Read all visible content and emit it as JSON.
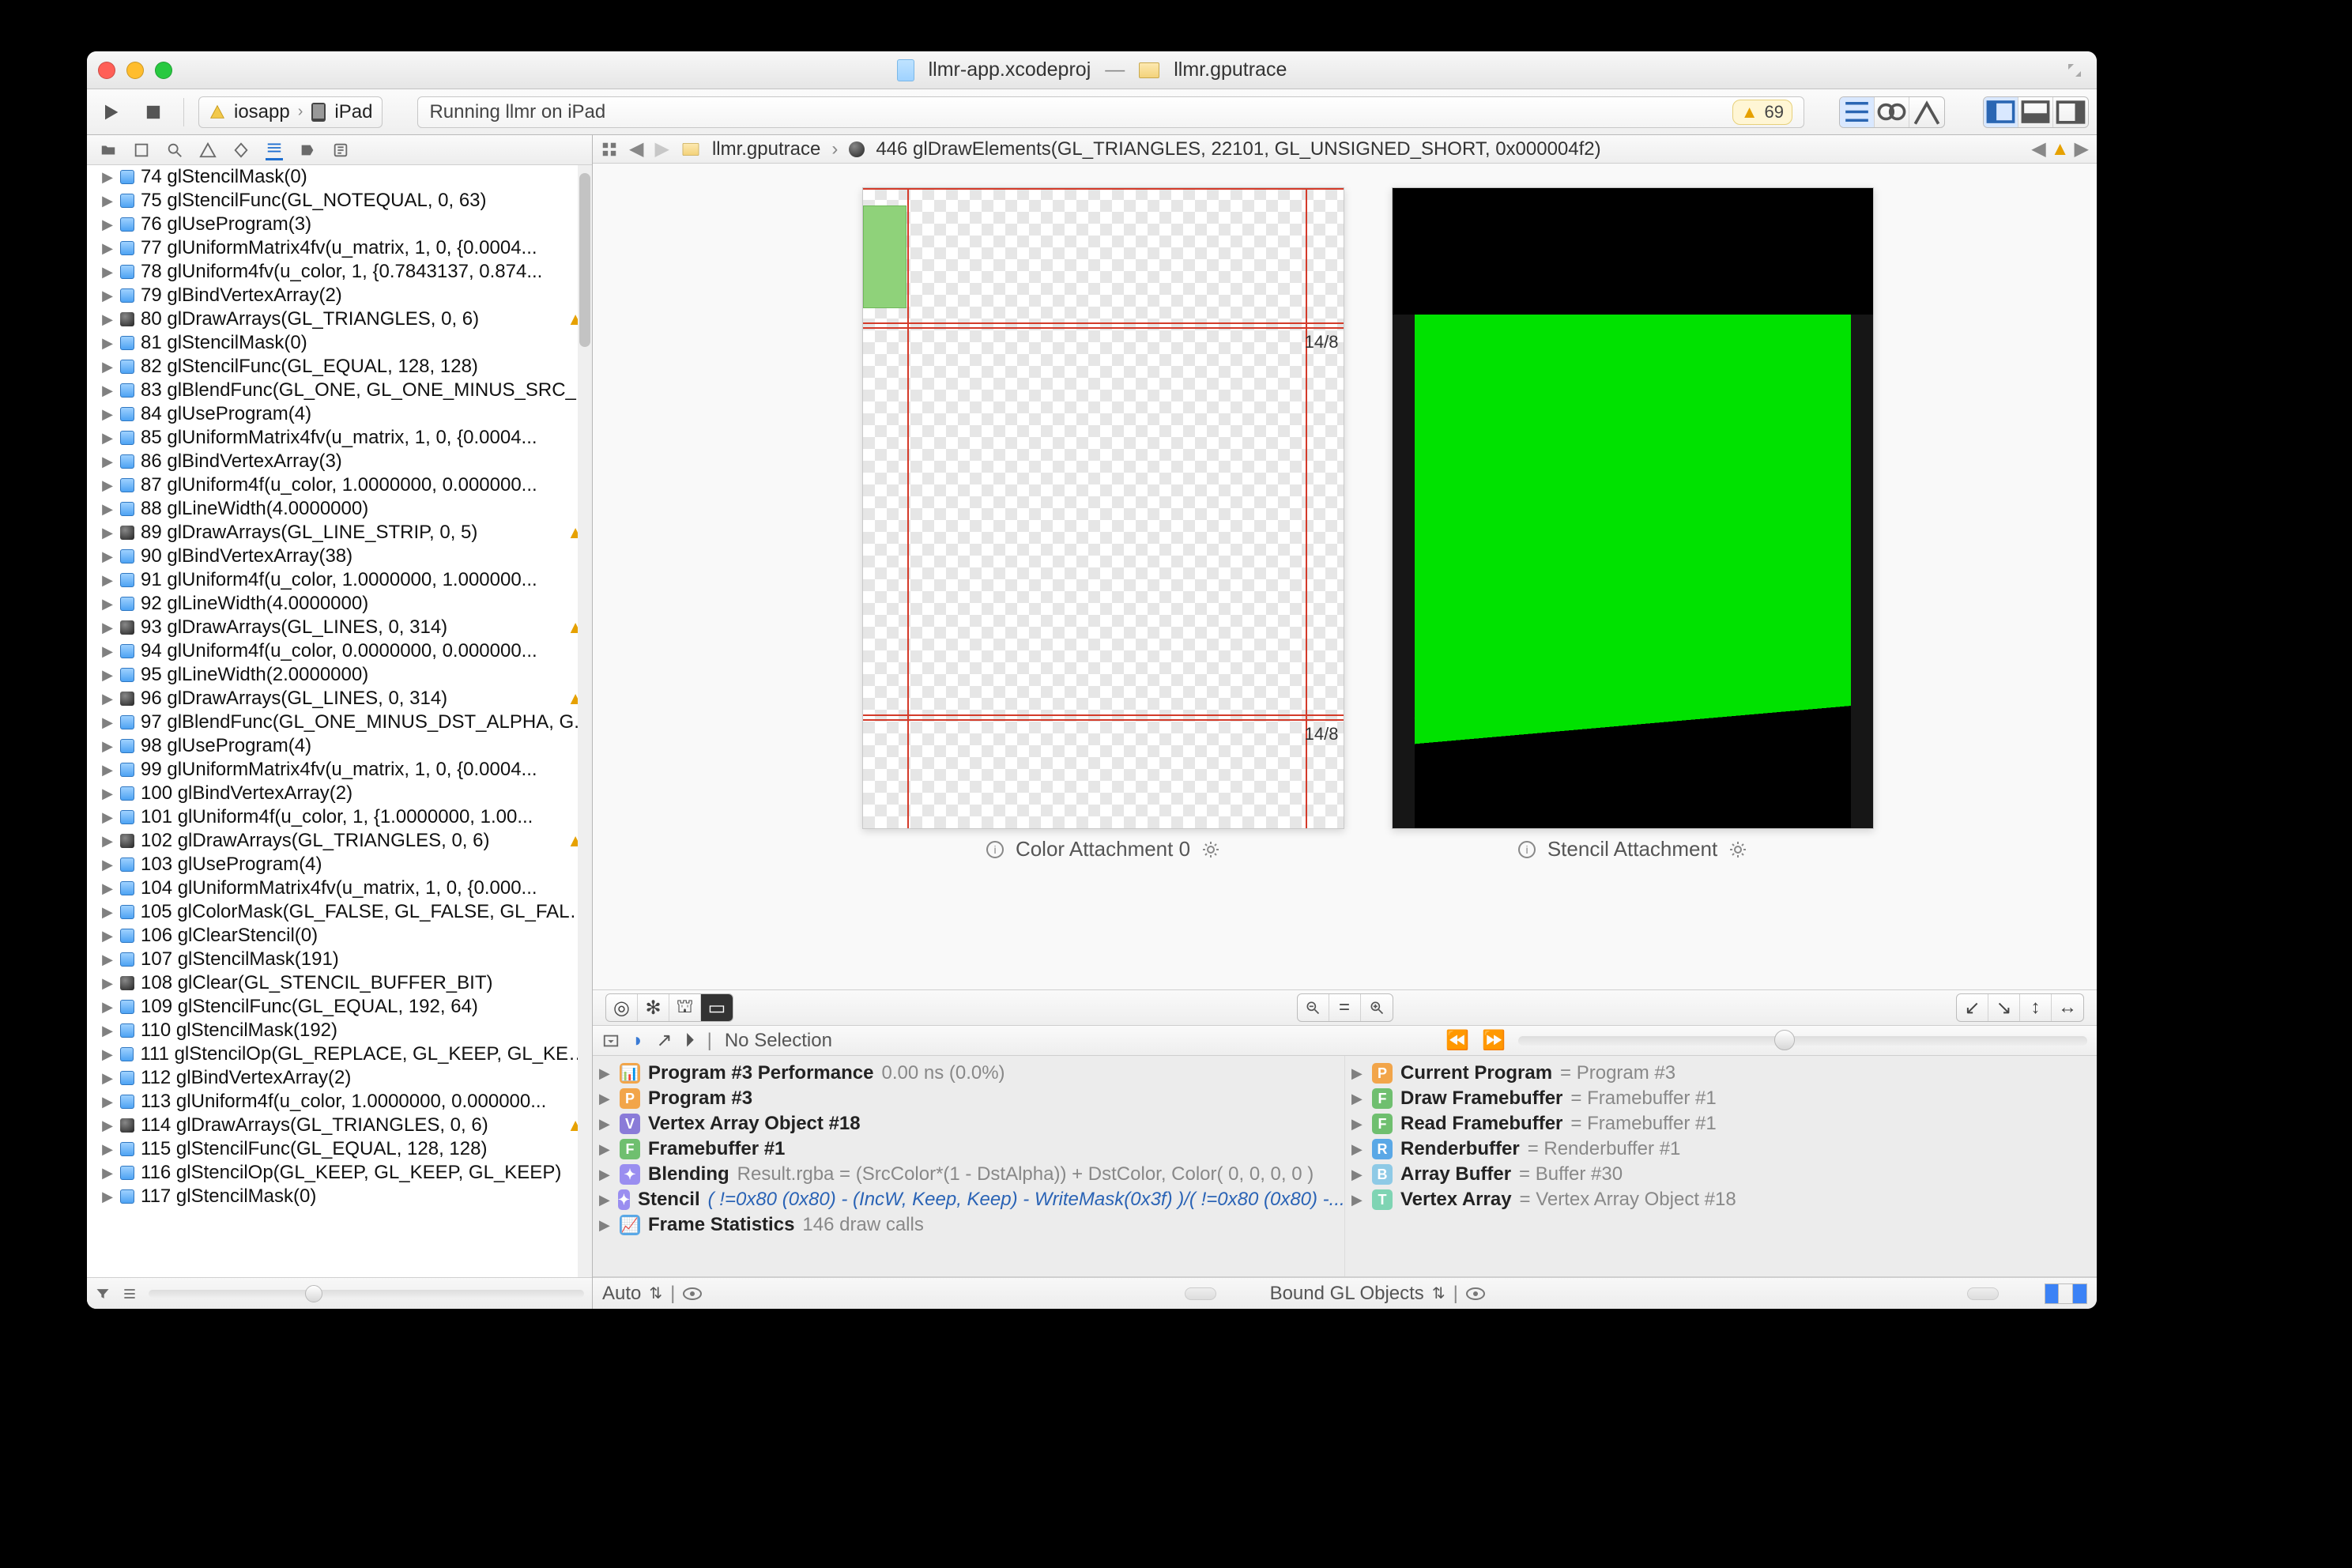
{
  "title": {
    "doc": "llmr-app.xcodeproj",
    "sep": "—",
    "trace": "llmr.gputrace"
  },
  "scheme": {
    "app": "iosapp",
    "device": "iPad"
  },
  "status": {
    "text": "Running llmr on iPad",
    "warn_count": "69"
  },
  "jump": {
    "file": "llmr.gputrace",
    "call": "446 glDrawElements(GL_TRIANGLES, 22101, GL_UNSIGNED_SHORT, 0x000004f2)"
  },
  "attachments": {
    "left": "Color Attachment 0",
    "right": "Stencil Attachment",
    "tag1": "14/8",
    "tag2": "14/8"
  },
  "selbar": {
    "label": "No Selection"
  },
  "bottom": {
    "auto": "Auto",
    "bound": "Bound GL Objects"
  },
  "tree_rows": [
    {
      "n": "74",
      "t": "glStencilMask(0)",
      "b": "blue"
    },
    {
      "n": "75",
      "t": "glStencilFunc(GL_NOTEQUAL, 0, 63)",
      "b": "blue"
    },
    {
      "n": "76",
      "t": "glUseProgram(3)",
      "b": "blue"
    },
    {
      "n": "77",
      "t": "glUniformMatrix4fv(u_matrix, 1, 0, {0.0004...",
      "b": "blue"
    },
    {
      "n": "78",
      "t": "glUniform4fv(u_color, 1, {0.7843137, 0.874...",
      "b": "blue"
    },
    {
      "n": "79",
      "t": "glBindVertexArray(2)",
      "b": "blue"
    },
    {
      "n": "80",
      "t": "glDrawArrays(GL_TRIANGLES, 0, 6)",
      "b": "dark",
      "w": true
    },
    {
      "n": "81",
      "t": "glStencilMask(0)",
      "b": "blue"
    },
    {
      "n": "82",
      "t": "glStencilFunc(GL_EQUAL, 128, 128)",
      "b": "blue"
    },
    {
      "n": "83",
      "t": "glBlendFunc(GL_ONE, GL_ONE_MINUS_SRC_...",
      "b": "blue"
    },
    {
      "n": "84",
      "t": "glUseProgram(4)",
      "b": "blue"
    },
    {
      "n": "85",
      "t": "glUniformMatrix4fv(u_matrix, 1, 0, {0.0004...",
      "b": "blue"
    },
    {
      "n": "86",
      "t": "glBindVertexArray(3)",
      "b": "blue"
    },
    {
      "n": "87",
      "t": "glUniform4f(u_color, 1.0000000, 0.000000...",
      "b": "blue"
    },
    {
      "n": "88",
      "t": "glLineWidth(4.0000000)",
      "b": "blue"
    },
    {
      "n": "89",
      "t": "glDrawArrays(GL_LINE_STRIP, 0, 5)",
      "b": "dark",
      "w": true
    },
    {
      "n": "90",
      "t": "glBindVertexArray(38)",
      "b": "blue"
    },
    {
      "n": "91",
      "t": "glUniform4f(u_color, 1.0000000, 1.000000...",
      "b": "blue"
    },
    {
      "n": "92",
      "t": "glLineWidth(4.0000000)",
      "b": "blue"
    },
    {
      "n": "93",
      "t": "glDrawArrays(GL_LINES, 0, 314)",
      "b": "dark",
      "w": true
    },
    {
      "n": "94",
      "t": "glUniform4f(u_color, 0.0000000, 0.000000...",
      "b": "blue"
    },
    {
      "n": "95",
      "t": "glLineWidth(2.0000000)",
      "b": "blue"
    },
    {
      "n": "96",
      "t": "glDrawArrays(GL_LINES, 0, 314)",
      "b": "dark",
      "w": true
    },
    {
      "n": "97",
      "t": "glBlendFunc(GL_ONE_MINUS_DST_ALPHA, G...",
      "b": "blue"
    },
    {
      "n": "98",
      "t": "glUseProgram(4)",
      "b": "blue"
    },
    {
      "n": "99",
      "t": "glUniformMatrix4fv(u_matrix, 1, 0, {0.0004...",
      "b": "blue"
    },
    {
      "n": "100",
      "t": "glBindVertexArray(2)",
      "b": "blue"
    },
    {
      "n": "101",
      "t": "glUniform4f(u_color, 1, {1.0000000, 1.00...",
      "b": "blue"
    },
    {
      "n": "102",
      "t": "glDrawArrays(GL_TRIANGLES, 0, 6)",
      "b": "dark",
      "w": true
    },
    {
      "n": "103",
      "t": "glUseProgram(4)",
      "b": "blue"
    },
    {
      "n": "104",
      "t": "glUniformMatrix4fv(u_matrix, 1, 0, {0.000...",
      "b": "blue"
    },
    {
      "n": "105",
      "t": "glColorMask(GL_FALSE, GL_FALSE, GL_FALS...",
      "b": "blue"
    },
    {
      "n": "106",
      "t": "glClearStencil(0)",
      "b": "blue"
    },
    {
      "n": "107",
      "t": "glStencilMask(191)",
      "b": "blue"
    },
    {
      "n": "108",
      "t": "glClear(GL_STENCIL_BUFFER_BIT)",
      "b": "dark"
    },
    {
      "n": "109",
      "t": "glStencilFunc(GL_EQUAL, 192, 64)",
      "b": "blue"
    },
    {
      "n": "110",
      "t": "glStencilMask(192)",
      "b": "blue"
    },
    {
      "n": "111",
      "t": "glStencilOp(GL_REPLACE, GL_KEEP, GL_KEEP)",
      "b": "blue"
    },
    {
      "n": "112",
      "t": "glBindVertexArray(2)",
      "b": "blue"
    },
    {
      "n": "113",
      "t": "glUniform4f(u_color, 1.0000000, 0.000000...",
      "b": "blue"
    },
    {
      "n": "114",
      "t": "glDrawArrays(GL_TRIANGLES, 0, 6)",
      "b": "dark",
      "w": true
    },
    {
      "n": "115",
      "t": "glStencilFunc(GL_EQUAL, 128, 128)",
      "b": "blue"
    },
    {
      "n": "116",
      "t": "glStencilOp(GL_KEEP, GL_KEEP, GL_KEEP)",
      "b": "blue"
    },
    {
      "n": "117",
      "t": "glStencilMask(0)",
      "b": "blue"
    }
  ],
  "insp_left": [
    {
      "ic": "ip-perf",
      "glyph": "📊",
      "k": "Program #3 Performance",
      "v": "0.00 ns (0.0%)"
    },
    {
      "ic": "ip-prog",
      "glyph": "P",
      "k": "Program #3",
      "v": ""
    },
    {
      "ic": "ip-vao",
      "glyph": "V",
      "k": "Vertex Array Object #18",
      "v": ""
    },
    {
      "ic": "ip-fb",
      "glyph": "F",
      "k": "Framebuffer #1",
      "v": ""
    },
    {
      "ic": "ip-blend",
      "glyph": "✦",
      "k": "Blending",
      "v": "Result.rgba = (SrcColor*(1 - DstAlpha)) + DstColor, Color( 0, 0, 0, 0 )",
      "plain": true
    },
    {
      "ic": "ip-stencil",
      "glyph": "✦",
      "k": "Stencil",
      "v": "( !=0x80 (0x80) - (IncW, Keep, Keep)  - WriteMask(0x3f) )/( !=0x80 (0x80) -...",
      "blue": true
    },
    {
      "ic": "ip-stats",
      "glyph": "📈",
      "k": "Frame Statistics",
      "v": "146 draw calls",
      "plain": true
    }
  ],
  "insp_right": [
    {
      "ic": "ip-cur",
      "glyph": "P",
      "k": "Current Program",
      "v": "= Program #3"
    },
    {
      "ic": "ip-draw",
      "glyph": "F",
      "k": "Draw Framebuffer",
      "v": "= Framebuffer #1"
    },
    {
      "ic": "ip-read",
      "glyph": "F",
      "k": "Read Framebuffer",
      "v": "= Framebuffer #1"
    },
    {
      "ic": "ip-rend",
      "glyph": "R",
      "k": "Renderbuffer",
      "v": "= Renderbuffer #1"
    },
    {
      "ic": "ip-arrbuf",
      "glyph": "B",
      "k": "Array Buffer",
      "v": "= Buffer #30"
    },
    {
      "ic": "ip-va",
      "glyph": "T",
      "k": "Vertex Array",
      "v": "= Vertex Array Object #18"
    }
  ]
}
